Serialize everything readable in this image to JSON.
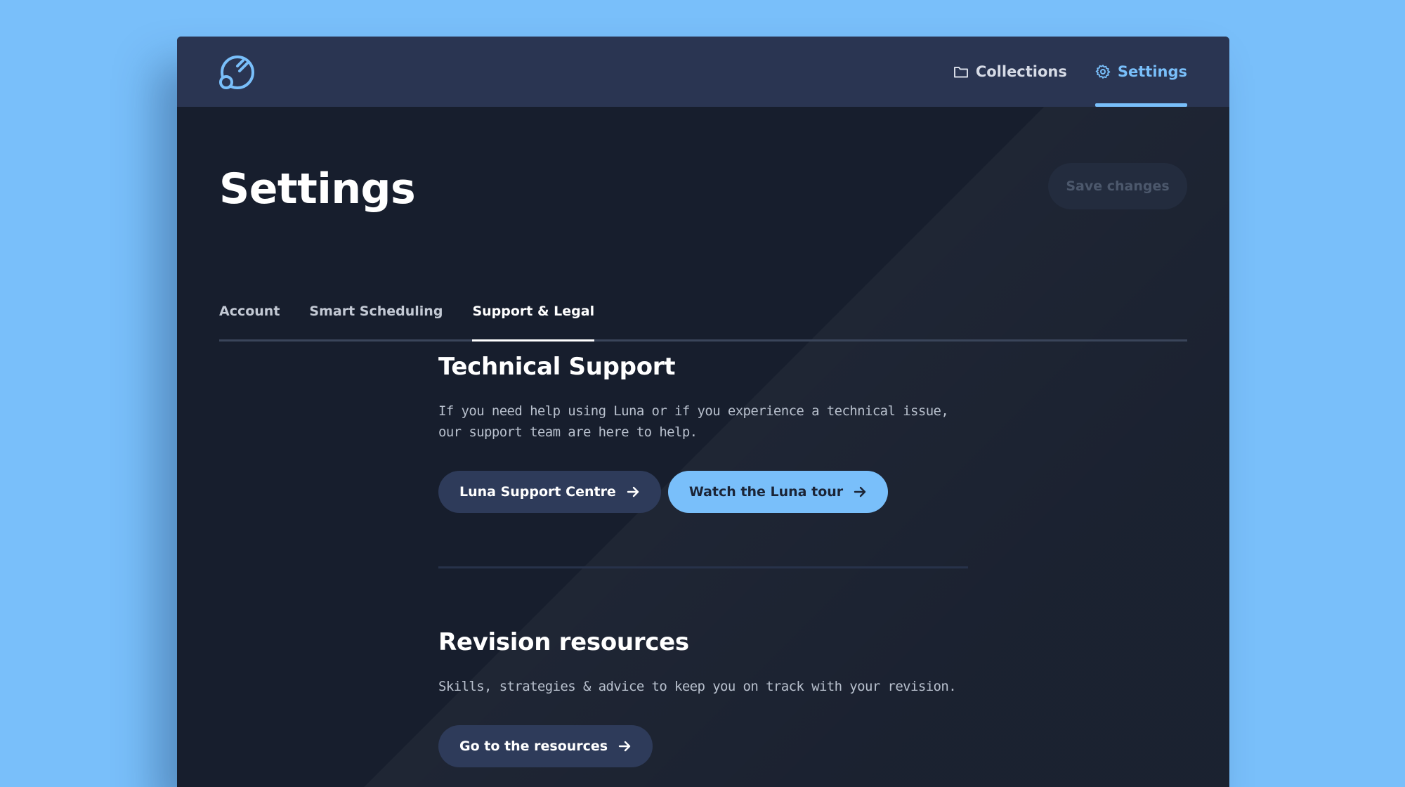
{
  "header": {
    "logo_icon": "luna-logo-icon",
    "nav": [
      {
        "label": "Collections",
        "icon": "folder-icon",
        "active": false
      },
      {
        "label": "Settings",
        "icon": "gear-icon",
        "active": true
      }
    ]
  },
  "page": {
    "title": "Settings",
    "save_label": "Save changes"
  },
  "tabs": [
    {
      "label": "Account",
      "active": false
    },
    {
      "label": "Smart Scheduling",
      "active": false
    },
    {
      "label": "Support & Legal",
      "active": true
    }
  ],
  "technical_support": {
    "title": "Technical Support",
    "description": "If you need help using Luna or if you experience a technical issue, our support team are here to help.",
    "support_centre_label": "Luna Support Centre",
    "tour_label": "Watch the Luna tour"
  },
  "revision_resources": {
    "title": "Revision resources",
    "description": "Skills, strategies & advice to keep you on track with your revision.",
    "resources_label": "Go to the resources"
  },
  "colors": {
    "accent": "#79bffa",
    "background": "#171e2d",
    "topbar": "#2a3552",
    "dark_button": "#2e3b5a"
  }
}
